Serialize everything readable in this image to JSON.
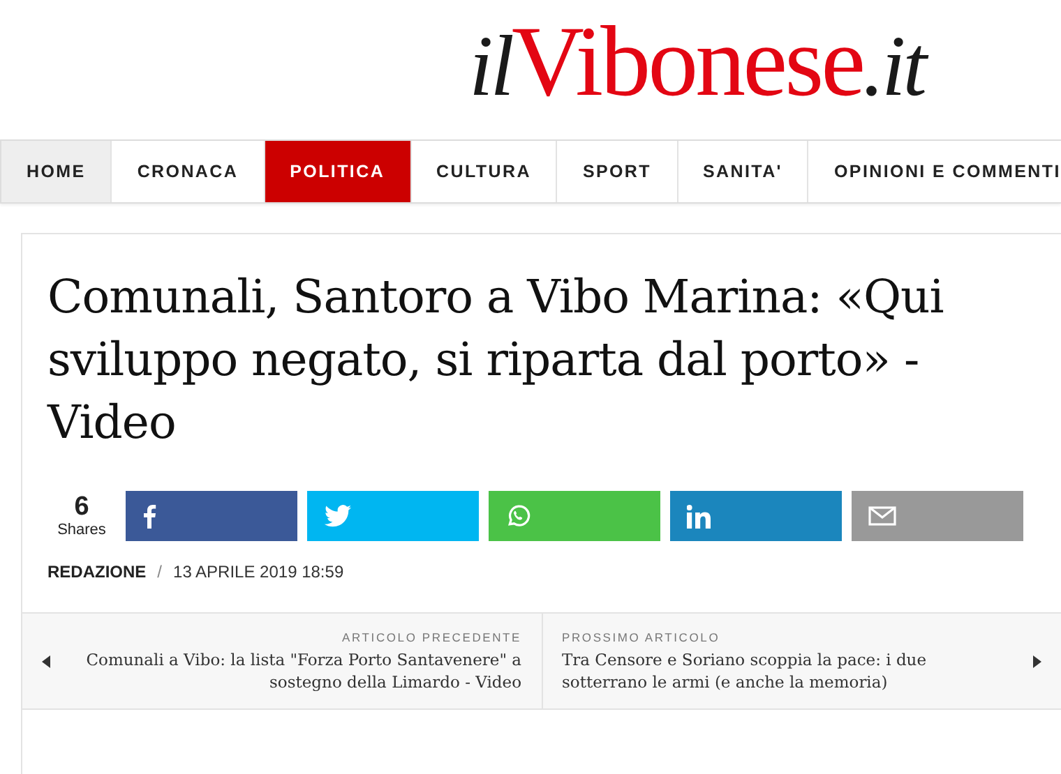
{
  "logo": {
    "prefix": "il",
    "name": "Vibonese",
    "suffix": ".it"
  },
  "nav": [
    {
      "label": "HOME",
      "selected": false,
      "kind": "home"
    },
    {
      "label": "CRONACA",
      "selected": false
    },
    {
      "label": "POLITICA",
      "selected": true
    },
    {
      "label": "CULTURA",
      "selected": false
    },
    {
      "label": "SPORT",
      "selected": false
    },
    {
      "label": "SANITA'",
      "selected": false
    },
    {
      "label": "OPINIONI E COMMENTI",
      "selected": false
    }
  ],
  "article": {
    "title": "Comunali, Santoro a Vibo Marina: «Qui sviluppo negato, si riparta dal porto» - Video",
    "shares": {
      "count": "6",
      "label": "Shares"
    },
    "share_buttons": [
      {
        "kind": "facebook"
      },
      {
        "kind": "twitter"
      },
      {
        "kind": "whatsapp"
      },
      {
        "kind": "linkedin"
      },
      {
        "kind": "email"
      }
    ],
    "author": "REDAZIONE",
    "separator": "/",
    "date": "13 APRILE 2019 18:59"
  },
  "article_nav": {
    "previous": {
      "label": "ARTICOLO PRECEDENTE",
      "title": "Comunali a Vibo: la lista \"Forza Porto Santavenere\" a sostegno della Limardo - Video"
    },
    "next": {
      "label": "PROSSIMO ARTICOLO",
      "title": "Tra Censore e Soriano scoppia la pace: i due sotterrano le armi (e anche la memoria)"
    }
  }
}
